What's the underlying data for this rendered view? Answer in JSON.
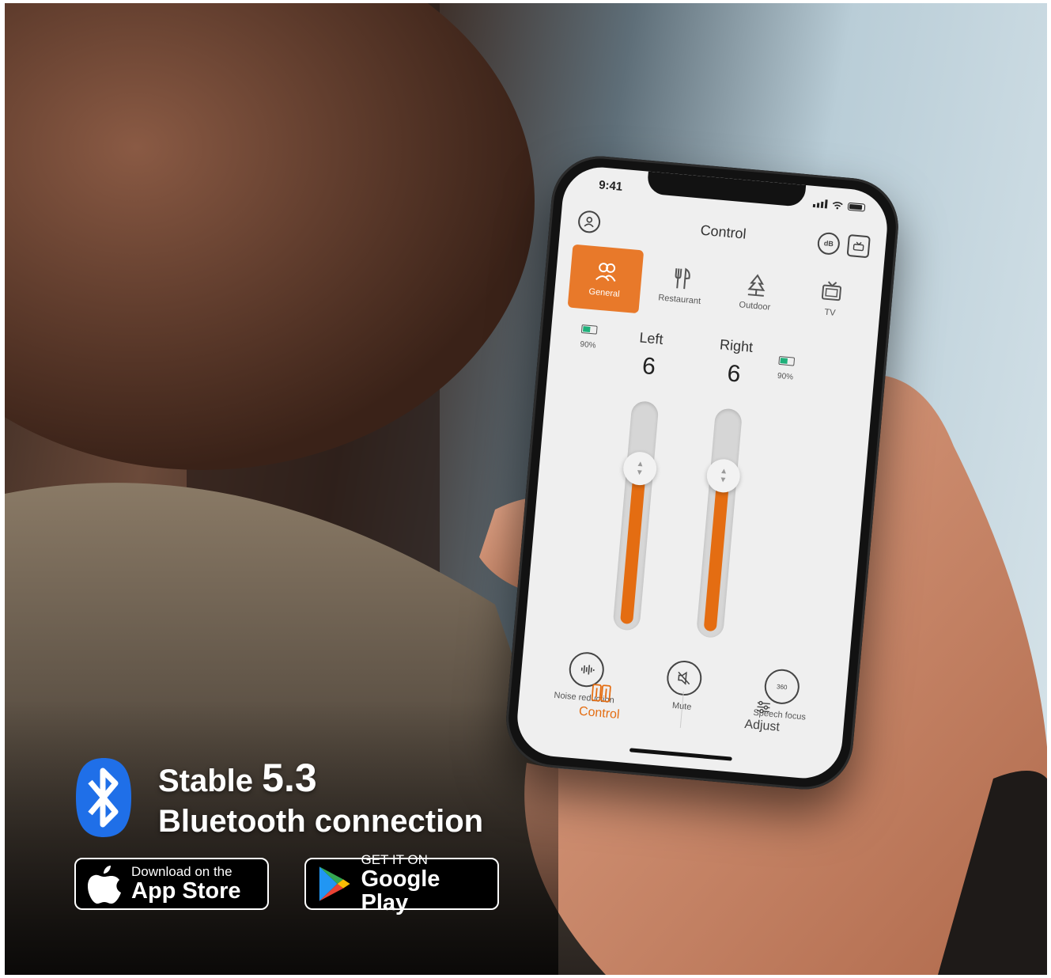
{
  "status": {
    "time": "9:41"
  },
  "app": {
    "title": "Control",
    "db_label": "dB",
    "modes": [
      {
        "label": "General",
        "icon": "people-icon",
        "active": true
      },
      {
        "label": "Restaurant",
        "icon": "fork-knife-icon",
        "active": false
      },
      {
        "label": "Outdoor",
        "icon": "tree-icon",
        "active": false
      },
      {
        "label": "TV",
        "icon": "tv-icon",
        "active": false
      }
    ],
    "left": {
      "label": "Left",
      "value": "6",
      "battery": "90%",
      "level": 0.72
    },
    "right": {
      "label": "Right",
      "value": "6",
      "battery": "90%",
      "level": 0.72
    },
    "actions": [
      {
        "label": "Noise reduction",
        "icon": "waveform-icon"
      },
      {
        "label": "Mute",
        "icon": "mute-icon"
      },
      {
        "label": "Speech focus",
        "icon": "360-icon",
        "icon_text": "360"
      }
    ],
    "tabs": [
      {
        "label": "Control",
        "icon": "control-icon",
        "active": true
      },
      {
        "label": "Adjust",
        "icon": "sliders-icon",
        "active": false
      }
    ]
  },
  "promo": {
    "line1_prefix": "Stable ",
    "line1_version": "5.3",
    "line2": "Bluetooth connection",
    "apple": {
      "small": "Download on the",
      "big": "App Store"
    },
    "google": {
      "small": "GET IT ON",
      "big": "Google Play"
    }
  },
  "colors": {
    "accent": "#e8792a",
    "bluetooth": "#1f6fe8",
    "battery": "#1fb07a"
  }
}
